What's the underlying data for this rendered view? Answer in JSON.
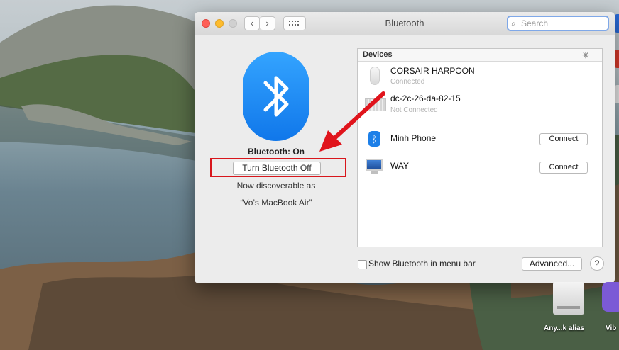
{
  "window": {
    "title": "Bluetooth",
    "search_placeholder": "Search"
  },
  "left_panel": {
    "status": "Bluetooth: On",
    "toggle_button": "Turn Bluetooth Off",
    "discoverable_line1": "Now discoverable as",
    "discoverable_line2": "“Vo’s MacBook Air”"
  },
  "devices": {
    "header": "Devices",
    "items": [
      {
        "name": "CORSAIR HARPOON",
        "status": "Connected",
        "icon": "mouse-icon"
      },
      {
        "name": "dc-2c-26-da-82-15",
        "status": "Not Connected",
        "icon": "keyboard-icon"
      },
      {
        "name": "Minh Phone",
        "action": "Connect",
        "icon": "bluetooth-phone-icon"
      },
      {
        "name": "WAY",
        "action": "Connect",
        "icon": "monitor-icon"
      }
    ]
  },
  "footer": {
    "show_in_menu_bar": "Show Bluetooth in menu bar",
    "show_in_menu_bar_checked": false,
    "advanced_button": "Advanced...",
    "help_button": "?"
  },
  "desktop": {
    "dock_label_1": "Any...k alias",
    "dock_label_2": "Vib"
  },
  "colors": {
    "highlight": "#d8161c",
    "bluetooth_blue": "#1a82f0"
  }
}
